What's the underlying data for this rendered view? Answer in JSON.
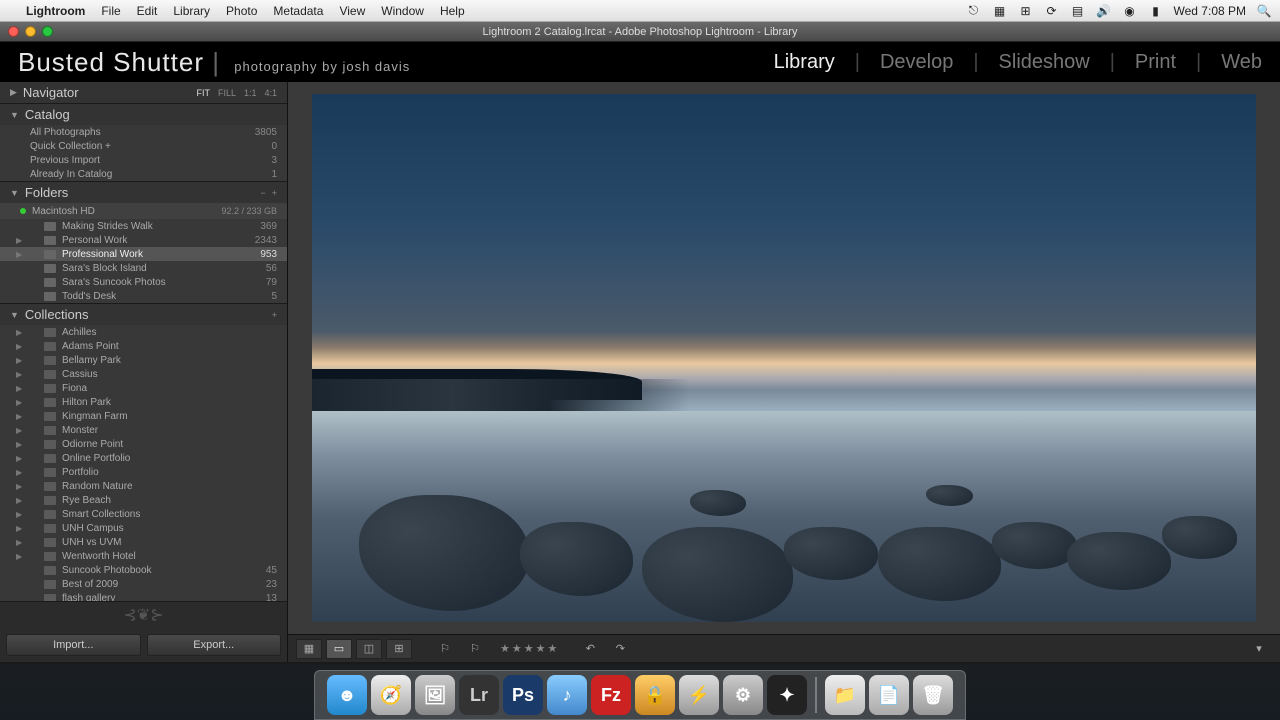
{
  "menubar": {
    "app": "Lightroom",
    "items": [
      "File",
      "Edit",
      "Library",
      "Photo",
      "Metadata",
      "View",
      "Window",
      "Help"
    ],
    "clock": "Wed 7:08 PM"
  },
  "window": {
    "title": "Lightroom 2 Catalog.lrcat - Adobe Photoshop Lightroom - Library"
  },
  "identity": {
    "main": "Busted Shutter",
    "sub": "photography by josh davis"
  },
  "modules": [
    "Library",
    "Develop",
    "Slideshow",
    "Print",
    "Web"
  ],
  "active_module": "Library",
  "navigator": {
    "label": "Navigator",
    "zoom": [
      "FIT",
      "FILL",
      "1:1",
      "4:1"
    ],
    "zoom_active": "FIT"
  },
  "catalog": {
    "label": "Catalog",
    "items": [
      {
        "name": "All Photographs",
        "count": "3805"
      },
      {
        "name": "Quick Collection  +",
        "count": "0"
      },
      {
        "name": "Previous Import",
        "count": "3"
      },
      {
        "name": "Already In Catalog",
        "count": "1"
      }
    ]
  },
  "folders": {
    "label": "Folders",
    "volume": {
      "name": "Macintosh HD",
      "space": "92.2 / 233 GB"
    },
    "items": [
      {
        "name": "Making Strides Walk",
        "count": "369",
        "expandable": false
      },
      {
        "name": "Personal Work",
        "count": "2343",
        "expandable": true
      },
      {
        "name": "Professional Work",
        "count": "953",
        "expandable": true,
        "selected": true
      },
      {
        "name": "Sara's Block Island",
        "count": "56",
        "expandable": false
      },
      {
        "name": "Sara's Suncook Photos",
        "count": "79",
        "expandable": false
      },
      {
        "name": "Todd's Desk",
        "count": "5",
        "expandable": false
      }
    ]
  },
  "collections": {
    "label": "Collections",
    "items": [
      {
        "name": "Achilles",
        "count": "",
        "expandable": true
      },
      {
        "name": "Adams Point",
        "count": "",
        "expandable": true
      },
      {
        "name": "Bellamy Park",
        "count": "",
        "expandable": true
      },
      {
        "name": "Cassius",
        "count": "",
        "expandable": true
      },
      {
        "name": "Fiona",
        "count": "",
        "expandable": true
      },
      {
        "name": "Hilton Park",
        "count": "",
        "expandable": true
      },
      {
        "name": "Kingman Farm",
        "count": "",
        "expandable": true
      },
      {
        "name": "Monster",
        "count": "",
        "expandable": true
      },
      {
        "name": "Odiorne Point",
        "count": "",
        "expandable": true
      },
      {
        "name": "Online Portfolio",
        "count": "",
        "expandable": true
      },
      {
        "name": "Portfolio",
        "count": "",
        "expandable": true
      },
      {
        "name": "Random Nature",
        "count": "",
        "expandable": true
      },
      {
        "name": "Rye Beach",
        "count": "",
        "expandable": true
      },
      {
        "name": "Smart Collections",
        "count": "",
        "expandable": true
      },
      {
        "name": "UNH Campus",
        "count": "",
        "expandable": true
      },
      {
        "name": "UNH vs UVM",
        "count": "",
        "expandable": true
      },
      {
        "name": "Wentworth Hotel",
        "count": "",
        "expandable": true
      },
      {
        "name": "Suncook Photobook",
        "count": "45",
        "expandable": false
      },
      {
        "name": "Best of 2009",
        "count": "23",
        "expandable": false
      },
      {
        "name": "flash gallery",
        "count": "13",
        "expandable": false
      }
    ]
  },
  "buttons": {
    "import": "Import...",
    "export": "Export..."
  },
  "dock": {
    "apps": [
      "Finder",
      "Safari",
      "Preview",
      "Lightroom",
      "Photoshop",
      "iTunes",
      "FileZilla",
      "Keychain",
      "Activity",
      "SysPrefs",
      "iMovie"
    ],
    "right": [
      "Downloads",
      "Documents",
      "Trash"
    ]
  }
}
